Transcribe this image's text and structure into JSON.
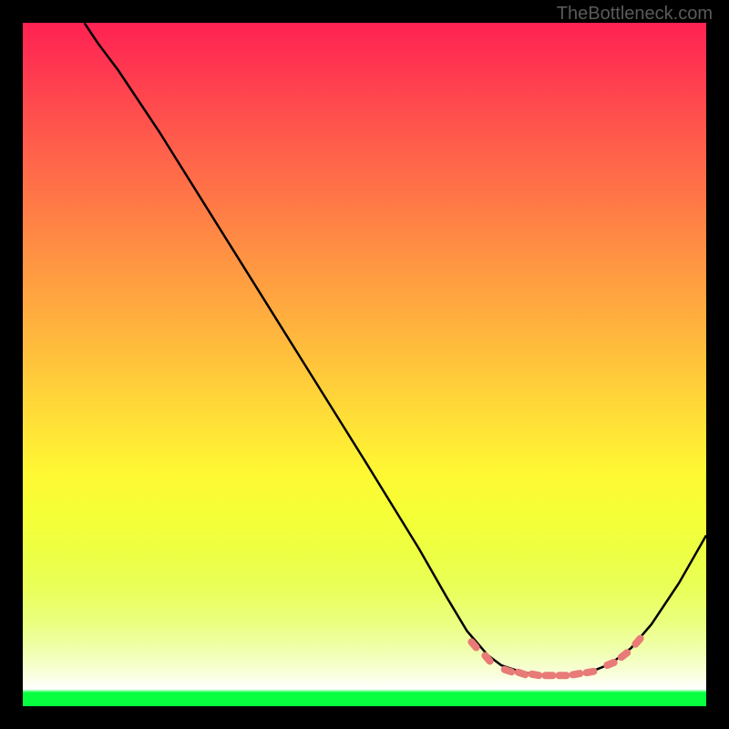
{
  "watermark": "TheBottleneck.com",
  "chart_data": {
    "type": "line",
    "title": "",
    "xlabel": "",
    "ylabel": "",
    "x_range": [
      0,
      100
    ],
    "y_range": [
      0,
      100
    ],
    "curve": [
      {
        "x": 9,
        "y": 100
      },
      {
        "x": 11,
        "y": 97
      },
      {
        "x": 14,
        "y": 93
      },
      {
        "x": 20,
        "y": 84
      },
      {
        "x": 30,
        "y": 68
      },
      {
        "x": 40,
        "y": 52
      },
      {
        "x": 50,
        "y": 36
      },
      {
        "x": 58,
        "y": 23
      },
      {
        "x": 62,
        "y": 16
      },
      {
        "x": 65,
        "y": 11
      },
      {
        "x": 68,
        "y": 7.5
      },
      {
        "x": 70,
        "y": 6
      },
      {
        "x": 73,
        "y": 5
      },
      {
        "x": 76,
        "y": 4.5
      },
      {
        "x": 80,
        "y": 4.5
      },
      {
        "x": 83,
        "y": 5
      },
      {
        "x": 86,
        "y": 6.2
      },
      {
        "x": 89,
        "y": 8.5
      },
      {
        "x": 92,
        "y": 12
      },
      {
        "x": 96,
        "y": 18
      },
      {
        "x": 100,
        "y": 25
      }
    ],
    "markers": [
      {
        "x": 66,
        "y": 9
      },
      {
        "x": 68,
        "y": 7
      },
      {
        "x": 71,
        "y": 5.2
      },
      {
        "x": 73,
        "y": 4.8
      },
      {
        "x": 75,
        "y": 4.6
      },
      {
        "x": 77,
        "y": 4.5
      },
      {
        "x": 79,
        "y": 4.5
      },
      {
        "x": 81,
        "y": 4.7
      },
      {
        "x": 83,
        "y": 5
      },
      {
        "x": 86,
        "y": 6.2
      },
      {
        "x": 88,
        "y": 7.5
      },
      {
        "x": 90,
        "y": 9.5
      }
    ],
    "gradient_colors": {
      "top": "#ff2253",
      "mid_orange": "#ff8545",
      "mid_yellow": "#ffe536",
      "bottom_band": "#08ff40"
    },
    "curve_color": "#000000",
    "marker_color": "#e87b77"
  }
}
